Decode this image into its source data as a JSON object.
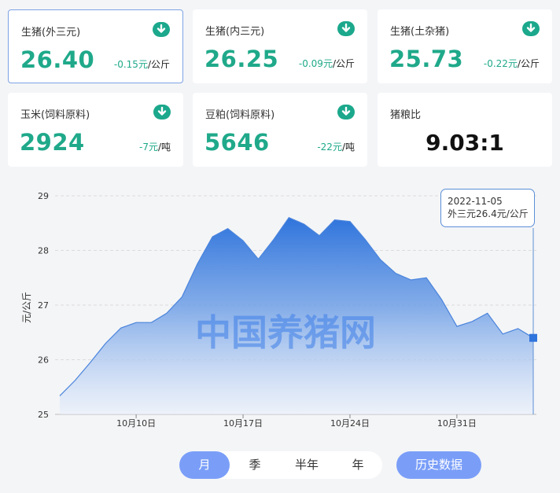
{
  "cards": [
    {
      "title": "生猪(外三元)",
      "price": "26.40",
      "change": "-0.15元",
      "unit": "/公斤",
      "active": true
    },
    {
      "title": "生猪(内三元)",
      "price": "26.25",
      "change": "-0.09元",
      "unit": "/公斤",
      "active": false
    },
    {
      "title": "生猪(土杂猪)",
      "price": "25.73",
      "change": "-0.22元",
      "unit": "/公斤",
      "active": false
    },
    {
      "title": "玉米(饲料原料)",
      "price": "2924",
      "change": "-7元",
      "unit": "/吨",
      "active": false
    },
    {
      "title": "豆粕(饲料原料)",
      "price": "5646",
      "change": "-22元",
      "unit": "/吨",
      "active": false
    }
  ],
  "ratio_card": {
    "title": "猪粮比",
    "value": "9.03:1"
  },
  "chart_data": {
    "type": "area",
    "ylabel": "元/公斤",
    "ylim": [
      25,
      29
    ],
    "yticks": [
      "25",
      "26",
      "27",
      "28",
      "29"
    ],
    "xticks": [
      {
        "label": "10月10日",
        "at": "2022-10-10"
      },
      {
        "label": "10月17日",
        "at": "2022-10-17"
      },
      {
        "label": "10月24日",
        "at": "2022-10-24"
      },
      {
        "label": "10月31日",
        "at": "2022-10-31"
      }
    ],
    "series": [
      {
        "dates": [
          "2022-10-05",
          "2022-10-06",
          "2022-10-07",
          "2022-10-08",
          "2022-10-09",
          "2022-10-10",
          "2022-10-11",
          "2022-10-12",
          "2022-10-13",
          "2022-10-14",
          "2022-10-15",
          "2022-10-16",
          "2022-10-17",
          "2022-10-18",
          "2022-10-19",
          "2022-10-20",
          "2022-10-21",
          "2022-10-22",
          "2022-10-23",
          "2022-10-24",
          "2022-10-25",
          "2022-10-26",
          "2022-10-27",
          "2022-10-28",
          "2022-10-29",
          "2022-10-30",
          "2022-10-31",
          "2022-11-01",
          "2022-11-02",
          "2022-11-03",
          "2022-11-04",
          "2022-11-05"
        ],
        "values": [
          25.34,
          25.62,
          25.95,
          26.3,
          26.58,
          26.68,
          26.68,
          26.85,
          27.15,
          27.75,
          28.25,
          28.4,
          28.18,
          27.84,
          28.2,
          28.6,
          28.48,
          28.27,
          28.56,
          28.53,
          28.2,
          27.83,
          27.58,
          27.46,
          27.5,
          27.1,
          26.61,
          26.7,
          26.85,
          26.47,
          26.57,
          26.4
        ]
      }
    ],
    "grid": true,
    "watermark": "中国养猪网",
    "tooltip": {
      "date": "2022-11-05",
      "label": "外三元",
      "value": "26.4元",
      "unit": "/公斤"
    }
  },
  "controls": {
    "options": [
      "月",
      "季",
      "半年",
      "年"
    ],
    "selected": "月",
    "history": "历史数据"
  },
  "colors": {
    "accent": "#1fa98a",
    "blue": "#3d7fe0",
    "button": "#7a9ef8"
  }
}
